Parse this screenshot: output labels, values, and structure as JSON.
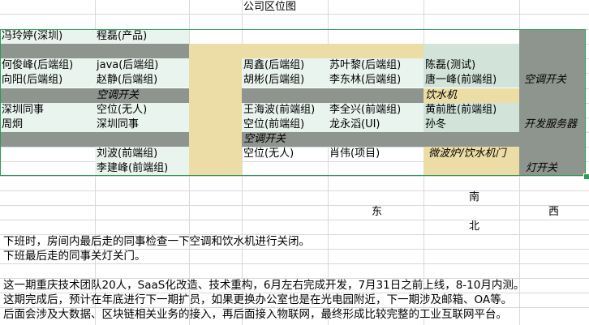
{
  "title": "公司区位图",
  "top_row": {
    "cell1": "冯玲婷(深圳)",
    "cell2": "程磊(产品)"
  },
  "left_area": {
    "r1c1": "何俊峰(后端组)",
    "r1c2": "java(后端组)",
    "r2c1": "向阳(后端组)",
    "r2c2": "赵静(后端组)",
    "ac_switch": "空调开关",
    "r4c1": "深圳同事",
    "r4c2": "空位(无人)",
    "r5c1": "周炯",
    "r5c2": "深圳同事",
    "r7c2": "刘波(前端组)",
    "r8c2": "李建峰(前端组)"
  },
  "center_area": {
    "r1c1": "周鑫(后端组)",
    "r1c2": "苏叶黎(后端组)",
    "r1c3": "陈磊(测试)",
    "r2c1": "胡彬(后端组)",
    "r2c2": "李东林(后端组)",
    "r2c3": "唐一峰(前端组)",
    "water_dispenser": "饮水机",
    "r4c1": "王海波(前端组)",
    "r4c2": "李全兴(前端组)",
    "r4c3": "黄前胜(前端组)",
    "r5c1": "空位(前端组)",
    "r5c2": "龙永滔(UI)",
    "r5c3": "孙冬",
    "ac_switch": "空调开关",
    "r7c1": "空位(无人)",
    "r7c2": "肖伟(项目)",
    "r7c3": "微波炉/饮水机门"
  },
  "right_area": {
    "ac_switch": "空调开关",
    "dev_server": "开发服务器",
    "light_switch": "灯开关"
  },
  "compass": {
    "south": "南",
    "east": "东",
    "west": "西",
    "north": "北"
  },
  "notes": [
    "下班时，房间内最后走的同事检查一下空调和饮水机进行关闭。",
    "下班最后走的同事关灯关门。",
    "",
    "这一期重庆技术团队20人，SaaS化改造、技术重构，6月左右完成开发，7月31日之前上线，8-10月内测。",
    "这期完成后，预计在年底进行下一期扩员，如果更换办公室也是在光电园附近，下一期涉及邮箱、OA等。",
    "后面会涉及大数据、区块链相关业务的接入，再后面接入物联网，最终形成比较完整的工业互联网平台。"
  ]
}
